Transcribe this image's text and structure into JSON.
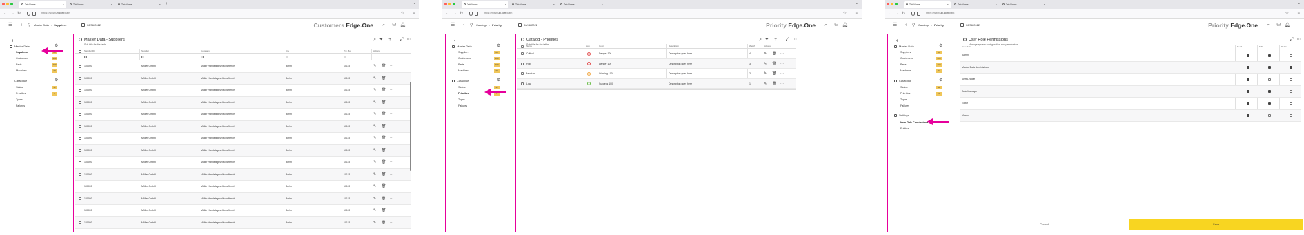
{
  "browser": {
    "tabs": [
      "Tab Name",
      "Tab Name",
      "Tab Name"
    ],
    "url_prefix": "https://www.",
    "url_domain": "url.com",
    "url_path": "/path"
  },
  "windows": [
    {
      "breadcrumb": [
        "Master Data",
        "Suppliers"
      ],
      "date": "06/06/2022",
      "brand_context": "Customers",
      "brand_name": "Edge.One",
      "page_title": "Master Data - Suppliers",
      "page_subtitle": "Sub title for the table",
      "columns": [
        "Supplier ID",
        "Supplier",
        "Company",
        "City",
        "P.C. Box",
        "Actions"
      ],
      "rows": [
        [
          "100000",
          "Müller GmbH",
          "Müller Handelsgesellschaft mbH",
          "Berlin",
          "10115"
        ],
        [
          "100000",
          "Müller GmbH",
          "Müller Handelsgesellschaft mbH",
          "Berlin",
          "10115"
        ],
        [
          "100000",
          "Müller GmbH",
          "Müller Handelsgesellschaft mbH",
          "Berlin",
          "10115"
        ],
        [
          "100000",
          "Müller GmbH",
          "Müller Handelsgesellschaft mbH",
          "Berlin",
          "10115"
        ],
        [
          "100000",
          "Müller GmbH",
          "Müller Handelsgesellschaft mbH",
          "Berlin",
          "10115"
        ],
        [
          "100000",
          "Müller GmbH",
          "Müller Handelsgesellschaft mbH",
          "Berlin",
          "10115"
        ],
        [
          "100000",
          "Müller GmbH",
          "Müller Handelsgesellschaft mbH",
          "Berlin",
          "10115"
        ],
        [
          "100000",
          "Müller GmbH",
          "Müller Handelsgesellschaft mbH",
          "Berlin",
          "10115"
        ],
        [
          "100000",
          "Müller GmbH",
          "Müller Handelsgesellschaft mbH",
          "Berlin",
          "10115"
        ],
        [
          "100000",
          "Müller GmbH",
          "Müller Handelsgesellschaft mbH",
          "Berlin",
          "10115"
        ],
        [
          "100000",
          "Müller GmbH",
          "Müller Handelsgesellschaft mbH",
          "Berlin",
          "10115"
        ],
        [
          "100000",
          "Müller GmbH",
          "Müller Handelsgesellschaft mbH",
          "Berlin",
          "10115"
        ],
        [
          "100000",
          "Müller GmbH",
          "Müller Handelsgesellschaft mbH",
          "Berlin",
          "10115"
        ],
        [
          "100000",
          "Müller GmbH",
          "Müller Handelsgesellschaft mbH",
          "Berlin",
          "10115"
        ]
      ]
    },
    {
      "breadcrumb": [
        "Catalogs",
        "Priority"
      ],
      "date": "06/06/2022",
      "brand_context": "Priority",
      "brand_name": "Edge.One",
      "page_title": "Catalog - Priorities",
      "page_subtitle": "Sub title for the table",
      "columns": [
        "Name",
        "Icon",
        "Color",
        "Description",
        "Weight",
        "Actions"
      ],
      "rows": [
        {
          "name": "Critical",
          "icon": "red",
          "color": "Danger 100",
          "desc": "Description goes here",
          "weight": "4"
        },
        {
          "name": "High",
          "icon": "red",
          "color": "Danger 100",
          "desc": "Description goes here",
          "weight": "3"
        },
        {
          "name": "Medium",
          "icon": "orange",
          "color": "Warning 100",
          "desc": "Description goes here",
          "weight": "2"
        },
        {
          "name": "Low",
          "icon": "green",
          "color": "Success 100",
          "desc": "Description goes here",
          "weight": "1"
        }
      ]
    },
    {
      "breadcrumb": [
        "Catalogs",
        "Priority"
      ],
      "date": "06/06/2022",
      "brand_context": "Priority",
      "brand_name": "Edge.One",
      "page_title": "User Role Permissions",
      "page_subtitle": "Manage system configuration and permissions",
      "columns": [
        "User Role",
        "Read",
        "Edit",
        "Delete"
      ],
      "rows": [
        {
          "role": "Admin",
          "read": true,
          "edit": true,
          "del": false
        },
        {
          "role": "Master Data Administrator",
          "read": true,
          "edit": true,
          "del": true
        },
        {
          "role": "Shift Leader",
          "read": true,
          "edit": false,
          "del": false
        },
        {
          "role": "Data Manager",
          "read": true,
          "edit": true,
          "del": false
        },
        {
          "role": "Editor",
          "read": true,
          "edit": true,
          "del": false
        },
        {
          "role": "Viewer",
          "read": true,
          "edit": false,
          "del": false
        }
      ],
      "cancel_label": "Cancel",
      "save_label": "Save"
    }
  ],
  "sidebar": {
    "master_data": "Master Data",
    "catalogue": "Catalogue",
    "settings": "Settings",
    "master_items": [
      {
        "label": "Suppliers",
        "badge": "20"
      },
      {
        "label": "Customers",
        "badge": "200"
      },
      {
        "label": "Parts",
        "badge": "200"
      },
      {
        "label": "Machines",
        "badge": "37"
      }
    ],
    "catalogue_items": [
      {
        "label": "Status",
        "badge": "12"
      },
      {
        "label": "Priorities",
        "badge": "4"
      },
      {
        "label": "Types",
        "badge": ""
      },
      {
        "label": "Failures",
        "badge": ""
      }
    ],
    "settings_items": [
      "User Role Permissions",
      "Entities"
    ]
  },
  "colors": {
    "highlight": "#e6009b",
    "badge": "#f0c659",
    "save": "#f8d521"
  }
}
